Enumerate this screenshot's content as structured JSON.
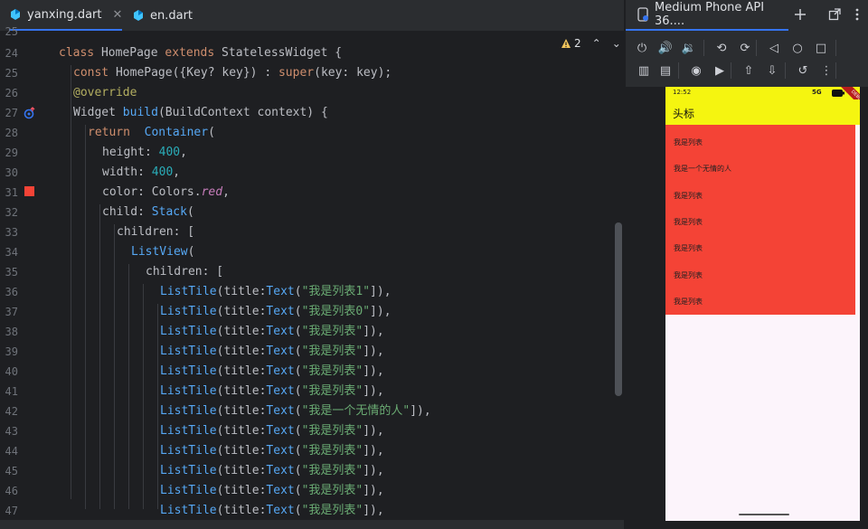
{
  "tabs": [
    {
      "label": "yanxing.dart",
      "active": true,
      "close": "✕"
    },
    {
      "label": "en.dart",
      "active": false
    }
  ],
  "gutter": {
    "line_numbers": [
      "25",
      "24",
      "25",
      "26",
      "27",
      "28",
      "29",
      "30",
      "31",
      "32",
      "33",
      "34",
      "35",
      "36",
      "37",
      "38",
      "39",
      "40",
      "41",
      "42",
      "43",
      "44",
      "45",
      "46",
      "47"
    ],
    "color_marker": "#f44336"
  },
  "inspection": {
    "warning_count": "2"
  },
  "code_lines": [
    [
      [
        "kw",
        "class "
      ],
      [
        "typ",
        "HomePage "
      ],
      [
        "kw",
        "extends "
      ],
      [
        "typ",
        "StatelessWidget {"
      ]
    ],
    [
      [
        "kw",
        "const "
      ],
      [
        "typ",
        "HomePage({Key? key}) : "
      ],
      [
        "kw",
        "super"
      ],
      [
        "typ",
        "(key: key);"
      ]
    ],
    [
      [
        "ann",
        "@override"
      ]
    ],
    [
      [
        "typ",
        "Widget "
      ],
      [
        "cls",
        "build"
      ],
      [
        "typ",
        "(BuildContext context) {"
      ]
    ],
    [
      [
        "kw",
        "return  "
      ],
      [
        "cls",
        "Container"
      ],
      [
        "typ",
        "("
      ]
    ],
    [
      [
        "typ",
        "height: "
      ],
      [
        "num",
        "400"
      ],
      [
        "typ",
        ","
      ]
    ],
    [
      [
        "typ",
        "width: "
      ],
      [
        "num",
        "400"
      ],
      [
        "typ",
        ","
      ]
    ],
    [
      [
        "typ",
        "color: Colors."
      ],
      [
        "ital",
        "red"
      ],
      [
        "typ",
        ","
      ]
    ],
    [
      [
        "typ",
        "child: "
      ],
      [
        "cls",
        "Stack"
      ],
      [
        "typ",
        "("
      ]
    ],
    [
      [
        "typ",
        "children: ["
      ]
    ],
    [
      [
        "cls",
        "ListView"
      ],
      [
        "typ",
        "("
      ]
    ],
    [
      [
        "typ",
        "children: ["
      ]
    ],
    [
      [
        "cls",
        "ListTile"
      ],
      [
        "typ",
        "(title:"
      ],
      [
        "cls",
        "Text"
      ],
      [
        "typ",
        "("
      ],
      [
        "str",
        "\"我是列表1\""
      ],
      [
        "typ",
        "]),"
      ]
    ],
    [
      [
        "cls",
        "ListTile"
      ],
      [
        "typ",
        "(title:"
      ],
      [
        "cls",
        "Text"
      ],
      [
        "typ",
        "("
      ],
      [
        "str",
        "\"我是列表0\""
      ],
      [
        "typ",
        "]),"
      ]
    ],
    [
      [
        "cls",
        "ListTile"
      ],
      [
        "typ",
        "(title:"
      ],
      [
        "cls",
        "Text"
      ],
      [
        "typ",
        "("
      ],
      [
        "str",
        "\"我是列表\""
      ],
      [
        "typ",
        "]),"
      ]
    ],
    [
      [
        "cls",
        "ListTile"
      ],
      [
        "typ",
        "(title:"
      ],
      [
        "cls",
        "Text"
      ],
      [
        "typ",
        "("
      ],
      [
        "str",
        "\"我是列表\""
      ],
      [
        "typ",
        "]),"
      ]
    ],
    [
      [
        "cls",
        "ListTile"
      ],
      [
        "typ",
        "(title:"
      ],
      [
        "cls",
        "Text"
      ],
      [
        "typ",
        "("
      ],
      [
        "str",
        "\"我是列表\""
      ],
      [
        "typ",
        "]),"
      ]
    ],
    [
      [
        "cls",
        "ListTile"
      ],
      [
        "typ",
        "(title:"
      ],
      [
        "cls",
        "Text"
      ],
      [
        "typ",
        "("
      ],
      [
        "str",
        "\"我是列表\""
      ],
      [
        "typ",
        "]),"
      ]
    ],
    [
      [
        "cls",
        "ListTile"
      ],
      [
        "typ",
        "(title:"
      ],
      [
        "cls",
        "Text"
      ],
      [
        "typ",
        "("
      ],
      [
        "str",
        "\"我是一个无情的人\""
      ],
      [
        "typ",
        "]),"
      ]
    ],
    [
      [
        "cls",
        "ListTile"
      ],
      [
        "typ",
        "(title:"
      ],
      [
        "cls",
        "Text"
      ],
      [
        "typ",
        "("
      ],
      [
        "str",
        "\"我是列表\""
      ],
      [
        "typ",
        "]),"
      ]
    ],
    [
      [
        "cls",
        "ListTile"
      ],
      [
        "typ",
        "(title:"
      ],
      [
        "cls",
        "Text"
      ],
      [
        "typ",
        "("
      ],
      [
        "str",
        "\"我是列表\""
      ],
      [
        "typ",
        "]),"
      ]
    ],
    [
      [
        "cls",
        "ListTile"
      ],
      [
        "typ",
        "(title:"
      ],
      [
        "cls",
        "Text"
      ],
      [
        "typ",
        "("
      ],
      [
        "str",
        "\"我是列表\""
      ],
      [
        "typ",
        "]),"
      ]
    ],
    [
      [
        "cls",
        "ListTile"
      ],
      [
        "typ",
        "(title:"
      ],
      [
        "cls",
        "Text"
      ],
      [
        "typ",
        "("
      ],
      [
        "str",
        "\"我是列表\""
      ],
      [
        "typ",
        "]),"
      ]
    ],
    [
      [
        "cls",
        "ListTile"
      ],
      [
        "typ",
        "(title:"
      ],
      [
        "cls",
        "Text"
      ],
      [
        "typ",
        "("
      ],
      [
        "str",
        "\"我是列表\""
      ],
      [
        "typ",
        "]),"
      ]
    ]
  ],
  "emulator": {
    "device_tab": "Medium Phone API 36....",
    "toolbar_icons": [
      "power-icon",
      "volume-up-icon",
      "volume-down-icon",
      "rotate-left-icon",
      "rotate-right-icon",
      "back-icon",
      "home-icon",
      "overview-icon",
      "fold-icon",
      "display-icon",
      "camera-icon",
      "record-icon",
      "upload-icon",
      "download-icon",
      "snapshot-icon",
      "more-icon"
    ],
    "status_time": "12:52",
    "status_right": "5G",
    "app_title": "头标",
    "list_items": [
      "我是列表",
      "我是一个无情的人",
      "我是列表",
      "我是列表",
      "我是列表",
      "我是列表",
      "我是列表"
    ],
    "debug_banner": "DEBUG",
    "colors": {
      "appbar": "#f5f510",
      "container": "#f44336",
      "background": "#fcf4fb"
    }
  }
}
